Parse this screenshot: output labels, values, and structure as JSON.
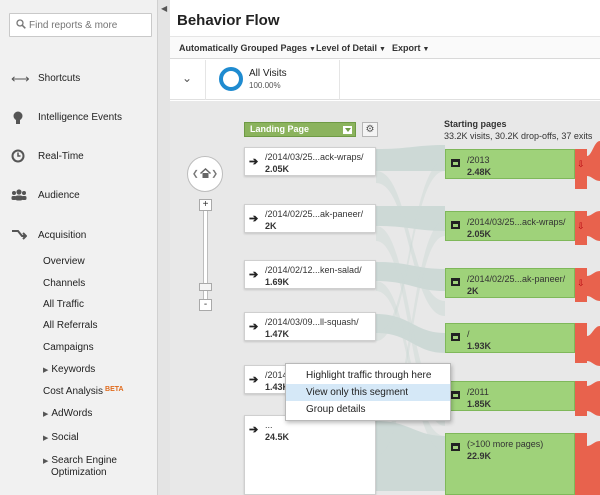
{
  "sidebar": {
    "search_placeholder": "Find reports & more",
    "collapse_glyph": "◀",
    "sections": [
      {
        "label": "Shortcuts",
        "icon": "shortcut-arrows-icon"
      },
      {
        "label": "Intelligence Events",
        "icon": "lightbulb-icon"
      },
      {
        "label": "Real-Time",
        "icon": "clock-icon"
      },
      {
        "label": "Audience",
        "icon": "people-icon"
      },
      {
        "label": "Acquisition",
        "icon": "acquisition-arrows-icon"
      }
    ],
    "subitems": [
      {
        "label": "Overview",
        "expandable": false
      },
      {
        "label": "Channels",
        "expandable": false
      },
      {
        "label": "All Traffic",
        "expandable": false
      },
      {
        "label": "All Referrals",
        "expandable": false
      },
      {
        "label": "Campaigns",
        "expandable": false
      },
      {
        "label": "Keywords",
        "expandable": true
      },
      {
        "label": "Cost Analysis",
        "expandable": false,
        "badge": "BETA"
      },
      {
        "label": "AdWords",
        "expandable": true
      },
      {
        "label": "Social",
        "expandable": true
      },
      {
        "label": "Search Engine",
        "label2": "Optimization",
        "expandable": true
      }
    ]
  },
  "header": {
    "title": "Behavior Flow"
  },
  "toolbar": {
    "grouped": "Automatically Grouped Pages",
    "detail": "Level of Detail",
    "export": "Export"
  },
  "segment": {
    "name": "All Visits",
    "percent": "100.00%",
    "color": "#1f8bd0"
  },
  "dimension": {
    "label": "Landing Page"
  },
  "landing_nodes": [
    {
      "title": "/2014/03/25...ack-wraps/",
      "value": "2.05K"
    },
    {
      "title": "/2014/02/25...ak-paneer/",
      "value": "2K"
    },
    {
      "title": "/2014/02/12...ken-salad/",
      "value": "1.69K"
    },
    {
      "title": "/2014/03/09...ll-squash/",
      "value": "1.47K"
    },
    {
      "title": "/2014",
      "value": "1.43K"
    },
    {
      "title": "...",
      "value": "24.5K"
    }
  ],
  "starting_pages": {
    "title": "Starting pages",
    "stats": "33.2K visits, 30.2K drop-offs, 37 exits",
    "nodes": [
      {
        "title": "/2013",
        "value": "2.48K"
      },
      {
        "title": "/2014/03/25...ack-wraps/",
        "value": "2.05K"
      },
      {
        "title": "/2014/02/25...ak-paneer/",
        "value": "2K"
      },
      {
        "title": "/",
        "value": "1.93K"
      },
      {
        "title": "/2011",
        "value": "1.85K"
      },
      {
        "title": "(>100 more pages)",
        "value": "22.9K"
      }
    ]
  },
  "context_menu": {
    "items": [
      "Highlight traffic through here",
      "View only this segment",
      "Group details"
    ],
    "highlighted_index": 1
  },
  "colors": {
    "page_node": "#9fd27a",
    "landing_select": "#8bb35d",
    "dropoff": "#e8624d",
    "flow": "#c9d7d4"
  }
}
